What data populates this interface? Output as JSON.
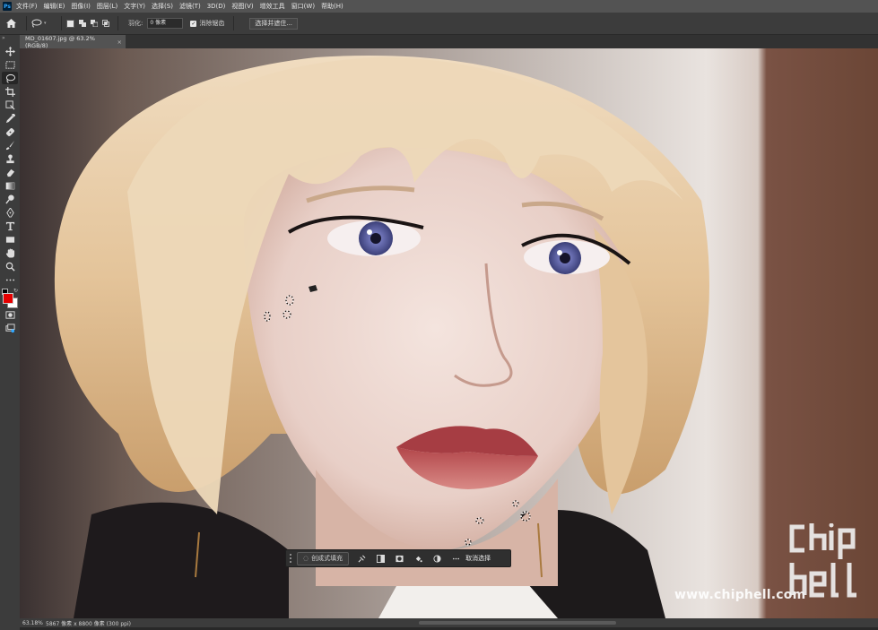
{
  "app": {
    "logo_text": "Ps"
  },
  "menu": [
    "文件(F)",
    "编辑(E)",
    "图像(I)",
    "图层(L)",
    "文字(Y)",
    "选择(S)",
    "滤镜(T)",
    "3D(D)",
    "视图(V)",
    "增效工具",
    "窗口(W)",
    "帮助(H)"
  ],
  "options_bar": {
    "feather_label": "羽化:",
    "feather_value": "0 像素",
    "antialias_label": "消除锯齿",
    "antialias_checked": true,
    "select_mask_label": "选择并遮住..."
  },
  "document": {
    "tab_title": "MD_01607.jpg @ 63.2%(RGB/8)",
    "close_glyph": "×"
  },
  "status_bar": {
    "zoom": "63.18%",
    "doc_info": "5867 像素 x 8800 像素 (300 ppi)"
  },
  "task_bar": {
    "generative_fill_label": "创成式填充",
    "deselect_label": "取消选择",
    "icons": [
      "modify-selection-icon",
      "invert-selection-icon",
      "mask-icon",
      "fill-icon",
      "adjustment-icon",
      "more-icon"
    ]
  },
  "toolbar": {
    "tools": [
      "move-tool-icon",
      "marquee-tool-icon",
      "lasso-tool-icon",
      "crop-tool-icon",
      "frame-tool-icon",
      "eyedropper-tool-icon",
      "healing-brush-icon",
      "brush-tool-icon",
      "clone-stamp-icon",
      "eraser-tool-icon",
      "gradient-tool-icon",
      "dodge-tool-icon",
      "pen-tool-icon",
      "type-tool-icon",
      "rectangle-tool-icon",
      "hand-tool-icon",
      "zoom-tool-icon",
      "more-tools-icon"
    ],
    "active_tool": "lasso-tool-icon",
    "foreground_color": "#e50000",
    "background_color": "#ffffff"
  },
  "watermark": {
    "url": "www.chiphell.com",
    "logo_text": "chip hell"
  }
}
